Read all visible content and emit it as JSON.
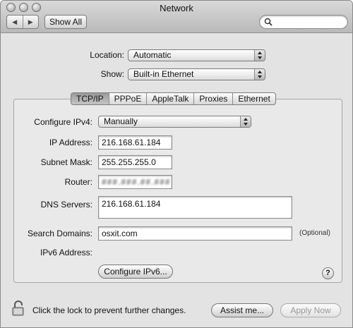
{
  "window": {
    "title": "Network"
  },
  "toolbar": {
    "back_glyph": "◀",
    "forward_glyph": "▶",
    "show_all": "Show All",
    "search_placeholder": ""
  },
  "location": {
    "label": "Location:",
    "value": "Automatic"
  },
  "show": {
    "label": "Show:",
    "value": "Built-in Ethernet"
  },
  "tabs": [
    {
      "label": "TCP/IP",
      "selected": true
    },
    {
      "label": "PPPoE"
    },
    {
      "label": "AppleTalk"
    },
    {
      "label": "Proxies"
    },
    {
      "label": "Ethernet"
    }
  ],
  "tcpip": {
    "configure_label": "Configure IPv4:",
    "configure_value": "Manually",
    "ip_label": "IP Address:",
    "ip_value": "216.168.61.184",
    "subnet_label": "Subnet Mask:",
    "subnet_value": "255.255.255.0",
    "router_label": "Router:",
    "router_value": "###.###.##.###",
    "dns_label": "DNS Servers:",
    "dns_value": "216.168.61.184",
    "search_label": "Search Domains:",
    "search_value": "osxit.com",
    "optional": "(Optional)",
    "ipv6_label": "IPv6 Address:",
    "configure_ipv6": "Configure IPv6..."
  },
  "help_glyph": "?",
  "footer": {
    "lock_text": "Click the lock to prevent further changes.",
    "assist": "Assist me...",
    "apply": "Apply Now"
  }
}
